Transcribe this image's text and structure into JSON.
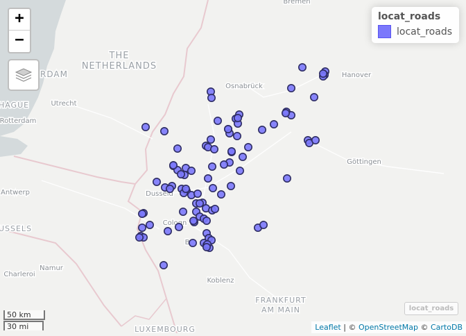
{
  "zoom": {
    "in_label": "+",
    "out_label": "−"
  },
  "legend": {
    "title": "locat_roads",
    "item_label": "locat_roads",
    "color": "#7b78fb"
  },
  "scale": {
    "km_label": "50 km",
    "mi_label": "30 mi"
  },
  "attribution": {
    "leaflet": "Leaflet",
    "sep1": " | © ",
    "osm": "OpenStreetMap",
    "sep2": " © ",
    "carto": "CartoDB"
  },
  "layer_tag": "locat_roads",
  "colors": {
    "land": "#f2f2f0",
    "sea": "#d4dadc",
    "border": "#e8c9cf",
    "marker_fill": "#7b78fb",
    "marker_stroke": "#2e2d63"
  },
  "map_labels": [
    {
      "id": "bremen",
      "text": "Bremen"
    },
    {
      "id": "netherlands1",
      "text": "THE"
    },
    {
      "id": "netherlands2",
      "text": "NETHERLANDS"
    },
    {
      "id": "amsterdam",
      "text": "RDAM"
    },
    {
      "id": "hanover",
      "text": "Hanover"
    },
    {
      "id": "osnabruck",
      "text": "Osnabrück"
    },
    {
      "id": "hague",
      "text": "HAGUE"
    },
    {
      "id": "utrecht",
      "text": "Utrecht"
    },
    {
      "id": "rotterdam",
      "text": "Rotterdam"
    },
    {
      "id": "gottingen",
      "text": "Göttingen"
    },
    {
      "id": "antwerp",
      "text": "Antwerp"
    },
    {
      "id": "dusseldorf",
      "text": "Dusseld"
    },
    {
      "id": "brussels",
      "text": "USSELS"
    },
    {
      "id": "cologne",
      "text": "Cologn"
    },
    {
      "id": "bonn",
      "text": "B"
    },
    {
      "id": "namur",
      "text": "Namur"
    },
    {
      "id": "charleroi",
      "text": "Charleroi"
    },
    {
      "id": "koblenz",
      "text": "Koblenz"
    },
    {
      "id": "frankfurt1",
      "text": "FRANKFURT"
    },
    {
      "id": "frankfurt2",
      "text": "AM MAIN"
    },
    {
      "id": "luxembourg",
      "text": "LUXEMBOURG"
    }
  ],
  "point_count": 97
}
